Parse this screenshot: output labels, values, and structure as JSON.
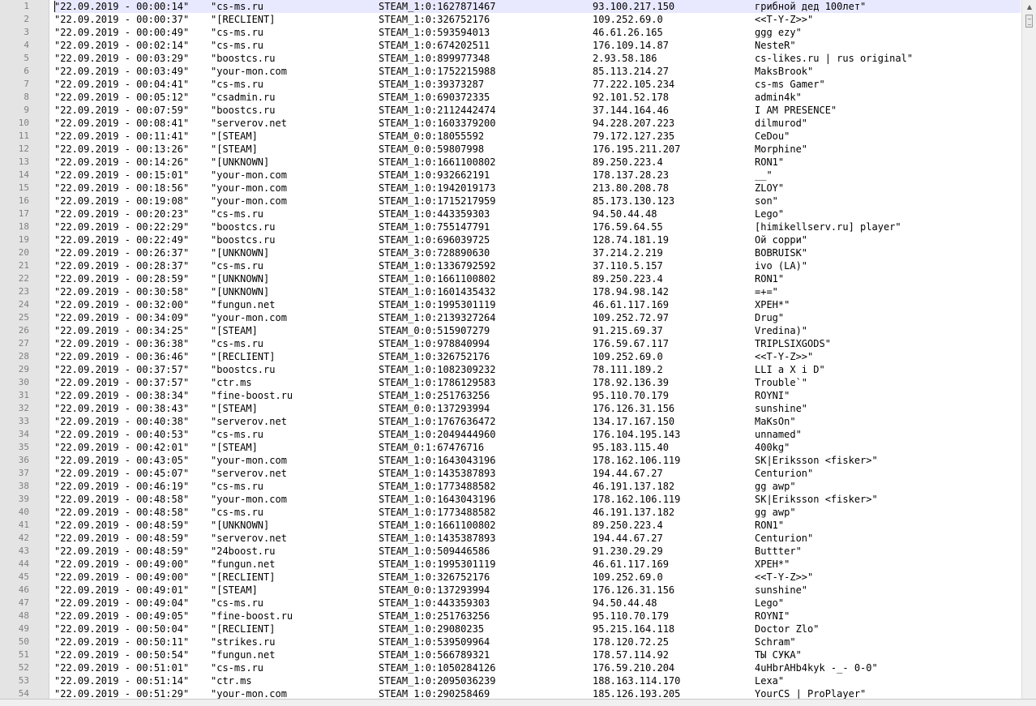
{
  "editor": {
    "scrollbar": {
      "up_icon": "triangle-up-icon"
    },
    "rows": [
      {
        "n": "1",
        "date": "\"22.09.2019 - 00:00:14\"",
        "src": "\"cs-ms.ru",
        "id": "STEAM_1:0:1627871467",
        "ip": "93.100.217.150",
        "name": "грибной дед 100лет\""
      },
      {
        "n": "2",
        "date": "\"22.09.2019 - 00:00:37\"",
        "src": "\"[RECLIENT]",
        "id": "STEAM_1:0:326752176",
        "ip": "109.252.69.0",
        "name": "<<T-Y-Z>>\""
      },
      {
        "n": "3",
        "date": "\"22.09.2019 - 00:00:49\"",
        "src": "\"cs-ms.ru",
        "id": "STEAM_1:0:593594013",
        "ip": "46.61.26.165",
        "name": "ggg ezy\""
      },
      {
        "n": "4",
        "date": "\"22.09.2019 - 00:02:14\"",
        "src": "\"cs-ms.ru",
        "id": "STEAM_1:0:674202511",
        "ip": "176.109.14.87",
        "name": "NesteR\""
      },
      {
        "n": "5",
        "date": "\"22.09.2019 - 00:03:29\"",
        "src": "\"boostcs.ru",
        "id": "STEAM_1:0:899977348",
        "ip": "2.93.58.186",
        "name": "cs-likes.ru | rus original\""
      },
      {
        "n": "6",
        "date": "\"22.09.2019 - 00:03:49\"",
        "src": "\"your-mon.com",
        "id": "STEAM_1:0:1752215988",
        "ip": "85.113.214.27",
        "name": "MaksBrook\""
      },
      {
        "n": "7",
        "date": "\"22.09.2019 - 00:04:41\"",
        "src": "\"cs-ms.ru",
        "id": "STEAM_1:0:39373287",
        "ip": "77.222.105.234",
        "name": "cs-ms Gamer\""
      },
      {
        "n": "8",
        "date": "\"22.09.2019 - 00:05:12\"",
        "src": "\"csadmin.ru",
        "id": "STEAM_1:0:690372335",
        "ip": "92.101.52.178",
        "name": "admin4k\""
      },
      {
        "n": "9",
        "date": "\"22.09.2019 - 00:07:59\"",
        "src": "\"boostcs.ru",
        "id": "STEAM_1:0:2112442474",
        "ip": "37.144.164.46",
        "name": "I AM PRESENCE\""
      },
      {
        "n": "10",
        "date": "\"22.09.2019 - 00:08:41\"",
        "src": "\"serverov.net",
        "id": "STEAM_1:0:1603379200",
        "ip": "94.228.207.223",
        "name": "dilmurod\""
      },
      {
        "n": "11",
        "date": "\"22.09.2019 - 00:11:41\"",
        "src": "\"[STEAM]",
        "id": "STEAM_0:0:18055592",
        "ip": "79.172.127.235",
        "name": "CeDou\""
      },
      {
        "n": "12",
        "date": "\"22.09.2019 - 00:13:26\"",
        "src": "\"[STEAM]",
        "id": "STEAM_0:0:59807998",
        "ip": "176.195.211.207",
        "name": "Morphine\""
      },
      {
        "n": "13",
        "date": "\"22.09.2019 - 00:14:26\"",
        "src": "\"[UNKNOWN]",
        "id": "STEAM_1:0:1661100802",
        "ip": "89.250.223.4",
        "name": "RON1\""
      },
      {
        "n": "14",
        "date": "\"22.09.2019 - 00:15:01\"",
        "src": "\"your-mon.com",
        "id": "STEAM_1:0:932662191",
        "ip": "178.137.28.23",
        "name": "__\""
      },
      {
        "n": "15",
        "date": "\"22.09.2019 - 00:18:56\"",
        "src": "\"your-mon.com",
        "id": "STEAM_1:0:1942019173",
        "ip": "213.80.208.78",
        "name": "ZLOY\""
      },
      {
        "n": "16",
        "date": "\"22.09.2019 - 00:19:08\"",
        "src": "\"your-mon.com",
        "id": "STEAM_1:0:1715217959",
        "ip": "85.173.130.123",
        "name": "son\""
      },
      {
        "n": "17",
        "date": "\"22.09.2019 - 00:20:23\"",
        "src": "\"cs-ms.ru",
        "id": "STEAM_1:0:443359303",
        "ip": "94.50.44.48",
        "name": "Lego\""
      },
      {
        "n": "18",
        "date": "\"22.09.2019 - 00:22:29\"",
        "src": "\"boostcs.ru",
        "id": "STEAM_1:0:755147791",
        "ip": "176.59.64.55",
        "name": "[himikellserv.ru] player\""
      },
      {
        "n": "19",
        "date": "\"22.09.2019 - 00:22:49\"",
        "src": "\"boostcs.ru",
        "id": "STEAM_1:0:696039725",
        "ip": "128.74.181.19",
        "name": "Ой сорри\""
      },
      {
        "n": "20",
        "date": "\"22.09.2019 - 00:26:37\"",
        "src": "\"[UNKNOWN]",
        "id": "STEAM_3:0:728890630",
        "ip": "37.214.2.219",
        "name": "BOBRUISK\""
      },
      {
        "n": "21",
        "date": "\"22.09.2019 - 00:28:37\"",
        "src": "\"cs-ms.ru",
        "id": "STEAM_1:0:1336792592",
        "ip": "37.110.5.157",
        "name": "ivo (LA)\""
      },
      {
        "n": "22",
        "date": "\"22.09.2019 - 00:28:59\"",
        "src": "\"[UNKNOWN]",
        "id": "STEAM_1:0:1661100802",
        "ip": "89.250.223.4",
        "name": "RON1\""
      },
      {
        "n": "23",
        "date": "\"22.09.2019 - 00:30:58\"",
        "src": "\"[UNKNOWN]",
        "id": "STEAM_1:0:1601435432",
        "ip": "178.94.98.142",
        "name": "=+=\""
      },
      {
        "n": "24",
        "date": "\"22.09.2019 - 00:32:00\"",
        "src": "\"fungun.net",
        "id": "STEAM_1:0:1995301119",
        "ip": "46.61.117.169",
        "name": "XPEH*\""
      },
      {
        "n": "25",
        "date": "\"22.09.2019 - 00:34:09\"",
        "src": "\"your-mon.com",
        "id": "STEAM_1:0:2139327264",
        "ip": "109.252.72.97",
        "name": "Drug\""
      },
      {
        "n": "26",
        "date": "\"22.09.2019 - 00:34:25\"",
        "src": "\"[STEAM]",
        "id": "STEAM_0:0:515907279",
        "ip": "91.215.69.37",
        "name": "Vredina)\""
      },
      {
        "n": "27",
        "date": "\"22.09.2019 - 00:36:38\"",
        "src": "\"cs-ms.ru",
        "id": "STEAM_1:0:978840994",
        "ip": "176.59.67.117",
        "name": "TRIPLSIXGODS\""
      },
      {
        "n": "28",
        "date": "\"22.09.2019 - 00:36:46\"",
        "src": "\"[RECLIENT]",
        "id": "STEAM_1:0:326752176",
        "ip": "109.252.69.0",
        "name": "<<T-Y-Z>>\""
      },
      {
        "n": "29",
        "date": "\"22.09.2019 - 00:37:57\"",
        "src": "\"boostcs.ru",
        "id": "STEAM_1:0:1082309232",
        "ip": "78.111.189.2",
        "name": "LLI a X i D\""
      },
      {
        "n": "30",
        "date": "\"22.09.2019 - 00:37:57\"",
        "src": "\"ctr.ms",
        "id": "STEAM_1:0:1786129583",
        "ip": "178.92.136.39",
        "name": "Trouble`\""
      },
      {
        "n": "31",
        "date": "\"22.09.2019 - 00:38:34\"",
        "src": "\"fine-boost.ru",
        "id": "STEAM_1:0:251763256",
        "ip": "95.110.70.179",
        "name": "ROYNI\""
      },
      {
        "n": "32",
        "date": "\"22.09.2019 - 00:38:43\"",
        "src": "\"[STEAM]",
        "id": "STEAM_0:0:137293994",
        "ip": "176.126.31.156",
        "name": "sunshine\""
      },
      {
        "n": "33",
        "date": "\"22.09.2019 - 00:40:38\"",
        "src": "\"serverov.net",
        "id": "STEAM_1:0:1767636472",
        "ip": "134.17.167.150",
        "name": "MaKsOn\""
      },
      {
        "n": "34",
        "date": "\"22.09.2019 - 00:40:53\"",
        "src": "\"cs-ms.ru",
        "id": "STEAM_1:0:2049444960",
        "ip": "176.104.195.143",
        "name": "unnamed\""
      },
      {
        "n": "35",
        "date": "\"22.09.2019 - 00:42:01\"",
        "src": "\"[STEAM]",
        "id": "STEAM_0:1:67476716",
        "ip": "95.183.115.40",
        "name": "400kg\""
      },
      {
        "n": "36",
        "date": "\"22.09.2019 - 00:43:05\"",
        "src": "\"your-mon.com",
        "id": "STEAM_1:0:1643043196",
        "ip": "178.162.106.119",
        "name": "SK|Eriksson <fisker>\""
      },
      {
        "n": "37",
        "date": "\"22.09.2019 - 00:45:07\"",
        "src": "\"serverov.net",
        "id": "STEAM_1:0:1435387893",
        "ip": "194.44.67.27",
        "name": "Centurion\""
      },
      {
        "n": "38",
        "date": "\"22.09.2019 - 00:46:19\"",
        "src": "\"cs-ms.ru",
        "id": "STEAM_1:0:1773488582",
        "ip": "46.191.137.182",
        "name": "gg awp\""
      },
      {
        "n": "39",
        "date": "\"22.09.2019 - 00:48:58\"",
        "src": "\"your-mon.com",
        "id": "STEAM_1:0:1643043196",
        "ip": "178.162.106.119",
        "name": "SK|Eriksson <fisker>\""
      },
      {
        "n": "40",
        "date": "\"22.09.2019 - 00:48:58\"",
        "src": "\"cs-ms.ru",
        "id": "STEAM_1:0:1773488582",
        "ip": "46.191.137.182",
        "name": "gg awp\""
      },
      {
        "n": "41",
        "date": "\"22.09.2019 - 00:48:59\"",
        "src": "\"[UNKNOWN]",
        "id": "STEAM_1:0:1661100802",
        "ip": "89.250.223.4",
        "name": "RON1\""
      },
      {
        "n": "42",
        "date": "\"22.09.2019 - 00:48:59\"",
        "src": "\"serverov.net",
        "id": "STEAM_1:0:1435387893",
        "ip": "194.44.67.27",
        "name": "Centurion\""
      },
      {
        "n": "43",
        "date": "\"22.09.2019 - 00:48:59\"",
        "src": "\"24boost.ru",
        "id": "STEAM_1:0:509446586",
        "ip": "91.230.29.29",
        "name": "Buttter\""
      },
      {
        "n": "44",
        "date": "\"22.09.2019 - 00:49:00\"",
        "src": "\"fungun.net",
        "id": "STEAM_1:0:1995301119",
        "ip": "46.61.117.169",
        "name": "XPEH*\""
      },
      {
        "n": "45",
        "date": "\"22.09.2019 - 00:49:00\"",
        "src": "\"[RECLIENT]",
        "id": "STEAM_1:0:326752176",
        "ip": "109.252.69.0",
        "name": "<<T-Y-Z>>\""
      },
      {
        "n": "46",
        "date": "\"22.09.2019 - 00:49:01\"",
        "src": "\"[STEAM]",
        "id": "STEAM_0:0:137293994",
        "ip": "176.126.31.156",
        "name": "sunshine\""
      },
      {
        "n": "47",
        "date": "\"22.09.2019 - 00:49:04\"",
        "src": "\"cs-ms.ru",
        "id": "STEAM_1:0:443359303",
        "ip": "94.50.44.48",
        "name": "Lego\""
      },
      {
        "n": "48",
        "date": "\"22.09.2019 - 00:49:05\"",
        "src": "\"fine-boost.ru",
        "id": "STEAM_1:0:251763256",
        "ip": "95.110.70.179",
        "name": "ROYNI\""
      },
      {
        "n": "49",
        "date": "\"22.09.2019 - 00:50:04\"",
        "src": "\"[RECLIENT]",
        "id": "STEAM_1:0:29080235",
        "ip": "95.215.164.118",
        "name": "Doctor Zlo\""
      },
      {
        "n": "50",
        "date": "\"22.09.2019 - 00:50:11\"",
        "src": "\"strikes.ru",
        "id": "STEAM_1:0:539509964",
        "ip": "178.120.72.25",
        "name": "Schram\""
      },
      {
        "n": "51",
        "date": "\"22.09.2019 - 00:50:54\"",
        "src": "\"fungun.net",
        "id": "STEAM_1:0:566789321",
        "ip": "178.57.114.92",
        "name": "ТЫ СУКА\""
      },
      {
        "n": "52",
        "date": "\"22.09.2019 - 00:51:01\"",
        "src": "\"cs-ms.ru",
        "id": "STEAM_1:0:1050284126",
        "ip": "176.59.210.204",
        "name": "4uHbrAHb4kyk -_- 0-0\""
      },
      {
        "n": "53",
        "date": "\"22.09.2019 - 00:51:14\"",
        "src": "\"ctr.ms",
        "id": "STEAM_1:0:2095036239",
        "ip": "188.163.114.170",
        "name": "Lexa\""
      },
      {
        "n": "54",
        "date": "\"22.09.2019 - 00:51:29\"",
        "src": "\"your-mon.com",
        "id": "STEAM_1:0:290258469",
        "ip": "185.126.193.205",
        "name": "YourCS | ProPlayer\""
      }
    ]
  }
}
